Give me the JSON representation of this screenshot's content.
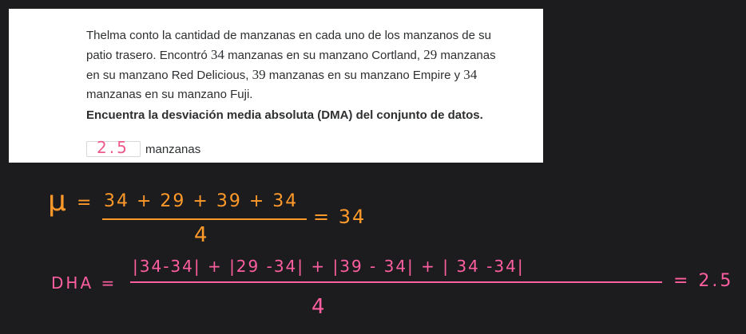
{
  "problem": {
    "text_before_1": "Thelma conto la cantidad de manzanas en cada uno de los manzanos de su patio trasero. Encontró ",
    "n1": "34",
    "text_before_2": " manzanas en su manzano Cortland, ",
    "n2": "29",
    "text_before_3": " manzanas en su manzano Red Delicious, ",
    "n3": "39",
    "text_before_4": " manzanas en su manzano Empire y ",
    "n4": "34",
    "text_after": " manzanas en su manzano Fuji.",
    "prompt": "Encuentra la desviación media absoluta (DMA) del conjunto de datos.",
    "answer_value": "2.5",
    "answer_unit": "manzanas"
  },
  "handwriting": {
    "mean_symbol": "μ",
    "mean_eq": "=",
    "mean_numerator": "34 + 29 + 39 + 34",
    "mean_denominator": "4",
    "mean_result": "= 34",
    "dha_label": "DHA =",
    "dha_numerator": "|34-34| + |29 -34| + |39 - 34| + | 34 -34|",
    "dha_denominator": "4",
    "dha_result": "= 2.5"
  },
  "colors": {
    "mean_ink": "#ff9a2a",
    "mad_ink": "#ff5ea0",
    "answer_ink": "#ee5b8a"
  }
}
